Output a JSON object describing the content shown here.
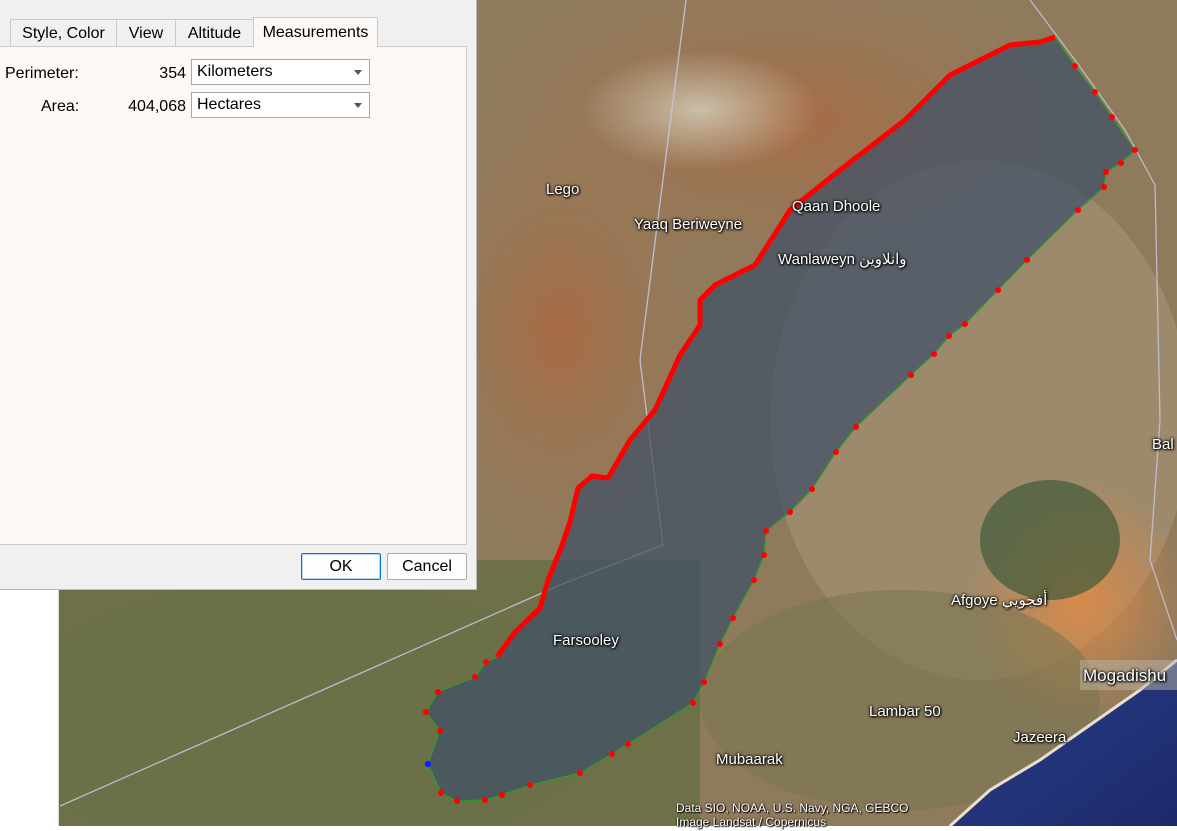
{
  "dialog": {
    "tabs": [
      {
        "label": "Style, Color",
        "active": false
      },
      {
        "label": "View",
        "active": false
      },
      {
        "label": "Altitude",
        "active": false
      },
      {
        "label": "Measurements",
        "active": true
      }
    ],
    "perimeter": {
      "label": "Perimeter:",
      "value": "354",
      "unit": "Kilometers"
    },
    "area": {
      "label": "Area:",
      "value": "404,068",
      "unit": "Hectares"
    },
    "ok_label": "OK",
    "cancel_label": "Cancel"
  },
  "map": {
    "places": [
      {
        "name": "Lego"
      },
      {
        "name": "Yaaq Beriweyne"
      },
      {
        "name": "Qaan Dhoole"
      },
      {
        "name": "Wanlaweyn وانلاوين"
      },
      {
        "name": "Farsooley"
      },
      {
        "name": "Afgoye أفجويي"
      },
      {
        "name": "Mogadishu"
      },
      {
        "name": "Lambar 50"
      },
      {
        "name": "Jazeera"
      },
      {
        "name": "Mubaarak"
      },
      {
        "name": "Bal"
      }
    ],
    "credits": [
      "Data SIO, NOAA, U.S. Navy, NGA, GEBCO",
      "Image Landsat / Copernicus"
    ],
    "colors": {
      "polygon_fill": "#4a5a6e",
      "measured_edge": "#ff0000",
      "outline": "#3aa63a",
      "vertex": "#ff0000",
      "start_vertex": "#1020ff"
    }
  }
}
